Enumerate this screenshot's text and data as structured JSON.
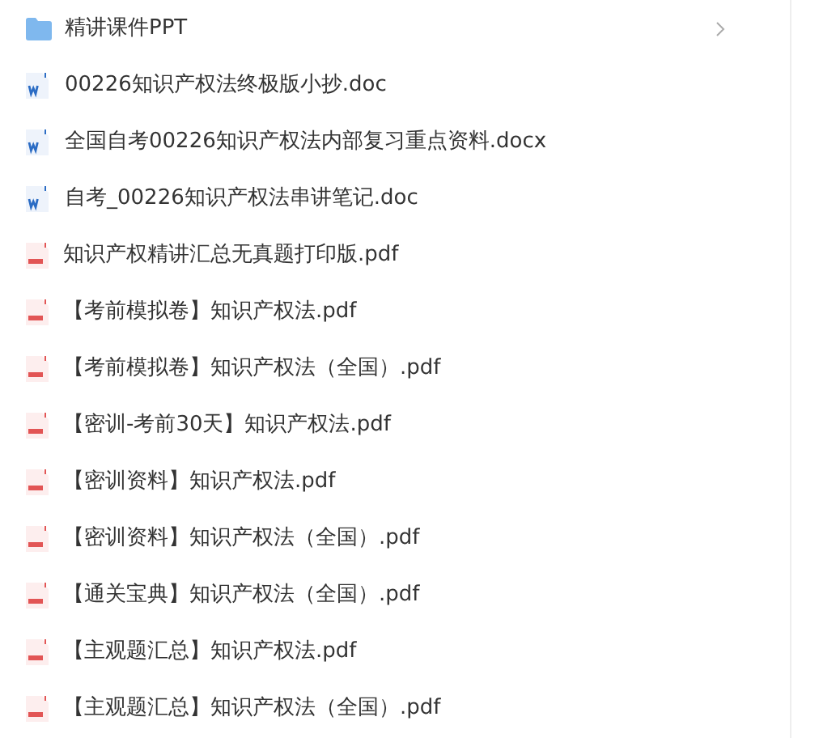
{
  "files": [
    {
      "kind": "folder",
      "name": "精讲课件PPT"
    },
    {
      "kind": "word",
      "name": "00226知识产权法终极版小抄.doc"
    },
    {
      "kind": "word",
      "name": "全国自考00226知识产权法内部复习重点资料.docx"
    },
    {
      "kind": "word",
      "name": "自考_00226知识产权法串讲笔记.doc"
    },
    {
      "kind": "pdf",
      "name": "知识产权精讲汇总无真题打印版.pdf"
    },
    {
      "kind": "pdf",
      "name": "【考前模拟卷】知识产权法.pdf"
    },
    {
      "kind": "pdf",
      "name": "【考前模拟卷】知识产权法（全国）.pdf"
    },
    {
      "kind": "pdf",
      "name": "【密训-考前30天】知识产权法.pdf"
    },
    {
      "kind": "pdf",
      "name": "【密训资料】知识产权法.pdf"
    },
    {
      "kind": "pdf",
      "name": "【密训资料】知识产权法（全国）.pdf"
    },
    {
      "kind": "pdf",
      "name": "【通关宝典】知识产权法（全国）.pdf"
    },
    {
      "kind": "pdf",
      "name": "【主观题汇总】知识产权法.pdf"
    },
    {
      "kind": "pdf",
      "name": "【主观题汇总】知识产权法（全国）.pdf"
    }
  ]
}
